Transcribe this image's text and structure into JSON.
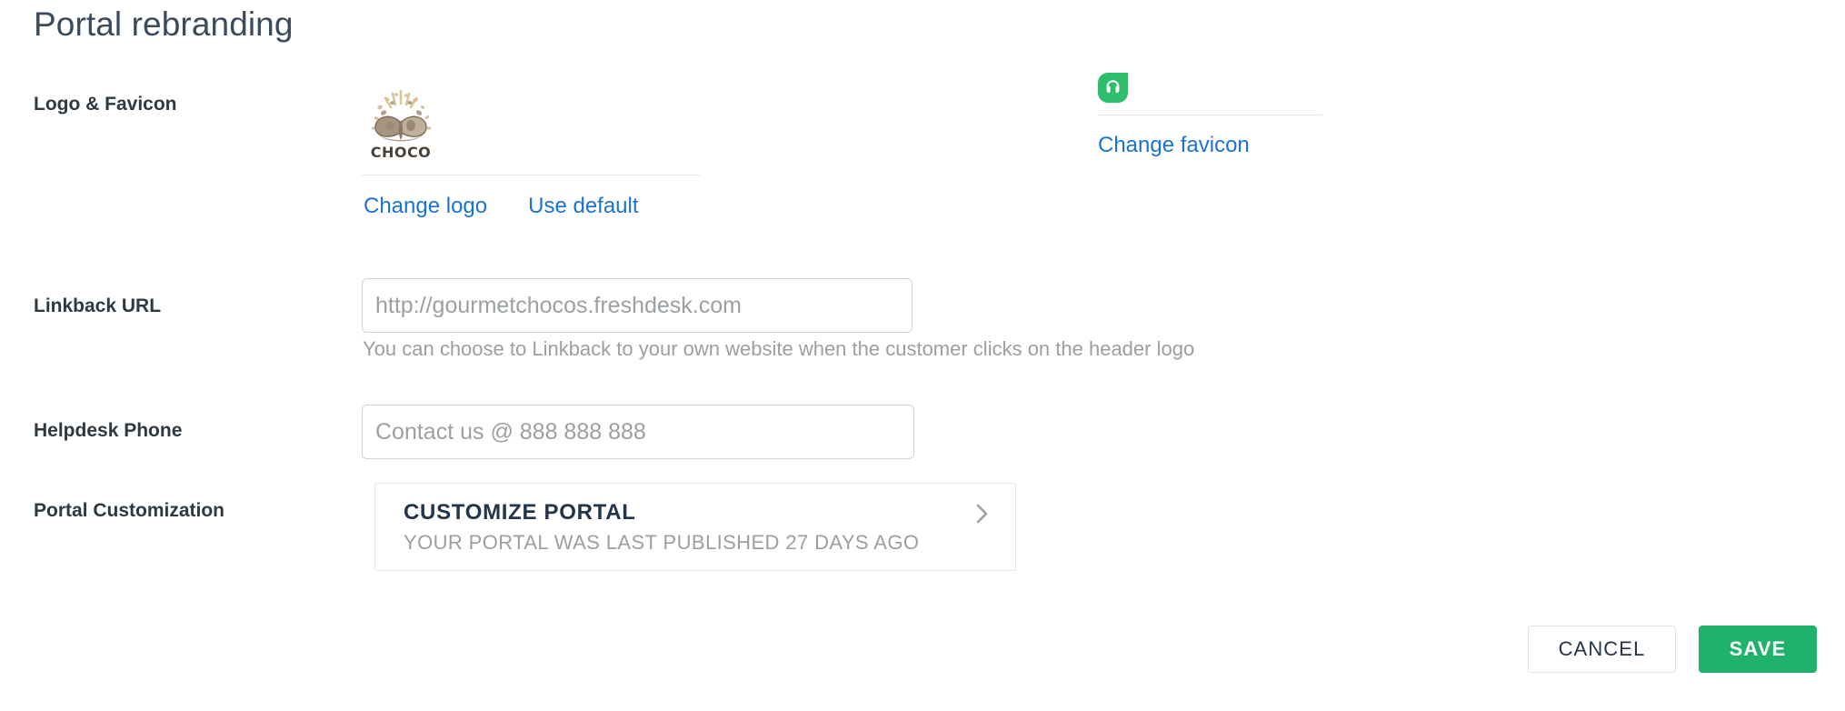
{
  "page": {
    "title": "Portal rebranding"
  },
  "colors": {
    "link": "#1a73d4",
    "save_green": "#20b26c",
    "favicon_green": "#2ebd6b",
    "title_slate": "#3b4b5c",
    "muted": "#9b9fa2"
  },
  "rows": {
    "logo_favicon": {
      "label": "Logo & Favicon",
      "logo": {
        "icon": "choco-brand-logo",
        "alt_text": "CHOCO",
        "wordmark": "CHOCO",
        "change_label": "Change logo",
        "default_label": "Use default"
      },
      "favicon": {
        "icon": "freshdesk-headset-favicon",
        "change_label": "Change favicon"
      }
    },
    "linkback_url": {
      "label": "Linkback URL",
      "value": "",
      "placeholder": "http://gourmetchocos.freshdesk.com",
      "help": "You can choose to Linkback to your own website when the customer clicks on the header logo"
    },
    "helpdesk_phone": {
      "label": "Helpdesk Phone",
      "value": "",
      "placeholder": "Contact us @ 888 888 888"
    },
    "portal_customization": {
      "label": "Portal Customization",
      "card": {
        "title": "CUSTOMIZE PORTAL",
        "subtitle": "YOUR PORTAL WAS LAST PUBLISHED 27 DAYS AGO",
        "chevron_icon": "chevron-right-icon"
      }
    }
  },
  "footer": {
    "cancel_label": "CANCEL",
    "save_label": "SAVE"
  }
}
